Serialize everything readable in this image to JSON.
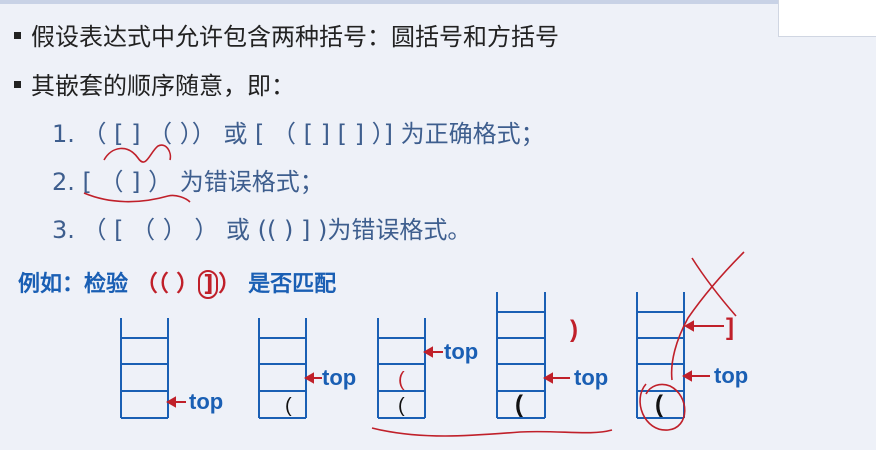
{
  "bullet1": "假设表达式中允许包含两种括号：圆括号和方括号",
  "bullet2": "其嵌套的顺序随意，即：",
  "items": [
    "1. （ [ ]  （ ）） 或 [ （ [ ]  [ ] ）] 为正确格式；",
    "2. [ （ ] ） 为错误格式；",
    "3. （ [ （ ） ） 或 (( ) ] )为错误格式。"
  ],
  "example": {
    "prefix": "例如：检验 ",
    "parens": "（（ ）",
    "boxed": "]",
    "close": "）",
    "suffix": " 是否匹配"
  },
  "stack_labels": {
    "top": "top",
    "paren_open": "(",
    "paren_close": ")",
    "bracket_close": "]"
  },
  "colors": {
    "accent_blue": "#1a5fb4",
    "annotation_red": "#c0202a",
    "item_text": "#3e5e8e"
  }
}
